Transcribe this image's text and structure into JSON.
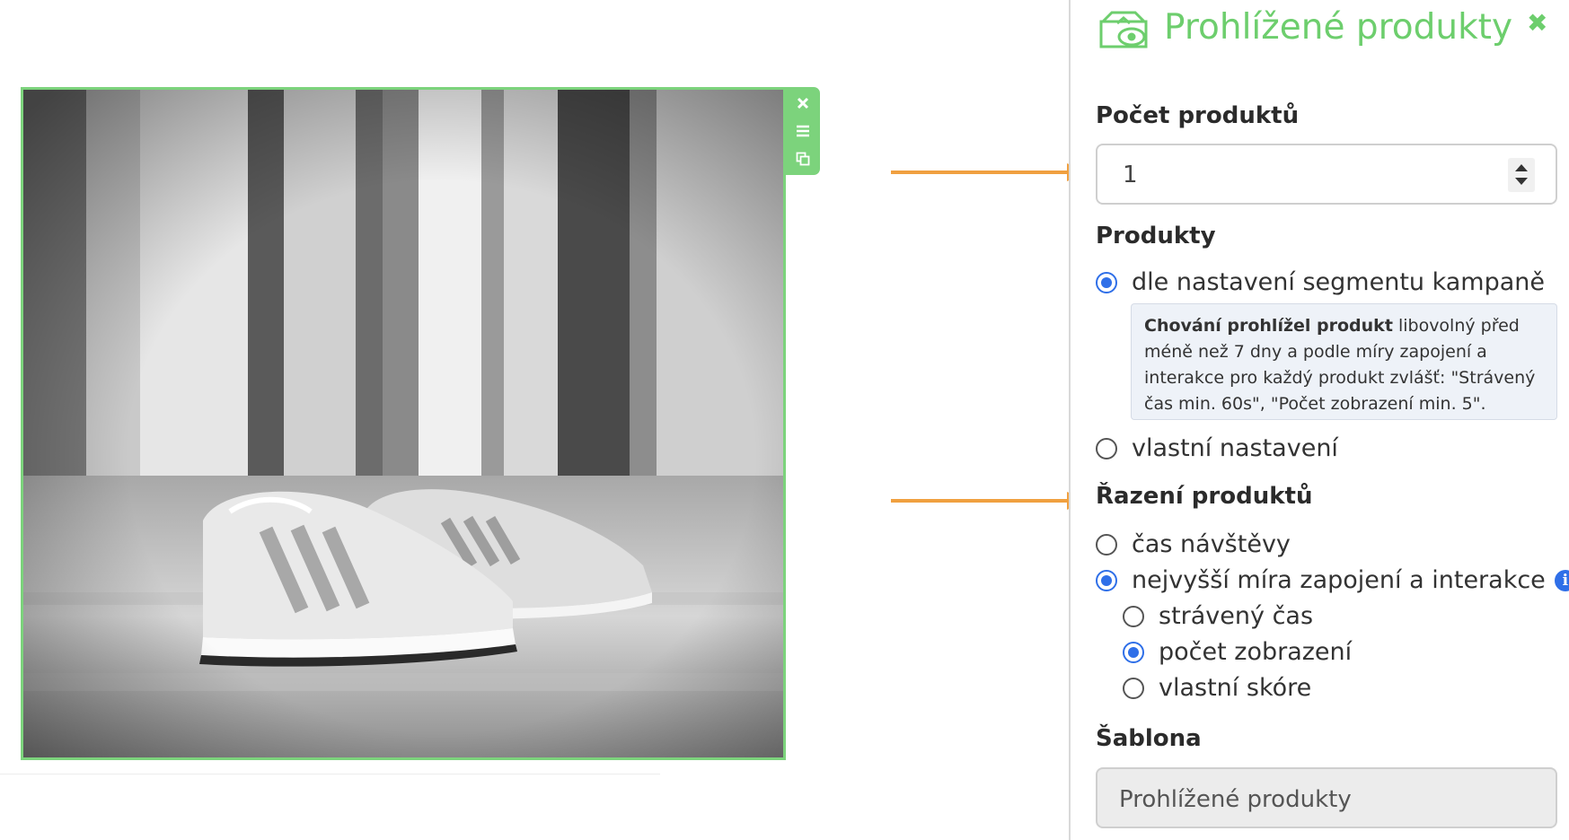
{
  "panel": {
    "title": "Prohlížené produkty",
    "close_icon": "close-icon",
    "accent_color": "#6dce6d"
  },
  "count": {
    "label": "Počet produktů",
    "value": "1"
  },
  "products": {
    "label": "Produkty",
    "option_segment": "dle nastavení segmentu kampaně",
    "option_segment_selected": true,
    "info_bold": "Chování prohlížel produkt",
    "info_text": " libovolný před méně než 7 dny a podle míry zapojení a interakce pro každý produkt zvlášť: \"Strávený čas min. 60s\", \"Počet zobrazení min. 5\".",
    "option_custom": "vlastní nastavení",
    "option_custom_selected": false
  },
  "sorting": {
    "label": "Řazení produktů",
    "option_visit_time": "čas návštěvy",
    "option_engagement": "nejvyšší míra zapojení a interakce",
    "option_engagement_selected": true,
    "sub_spent_time": "strávený čas",
    "sub_views": "počet zobrazení",
    "sub_views_selected": true,
    "sub_custom_score": "vlastní skóre"
  },
  "template": {
    "label": "Šablona",
    "value": "Prohlížené produkty"
  },
  "colors": {
    "radio_selected": "#2f6fe8",
    "arrow": "#f0a040",
    "block_border": "#7cd37c"
  }
}
